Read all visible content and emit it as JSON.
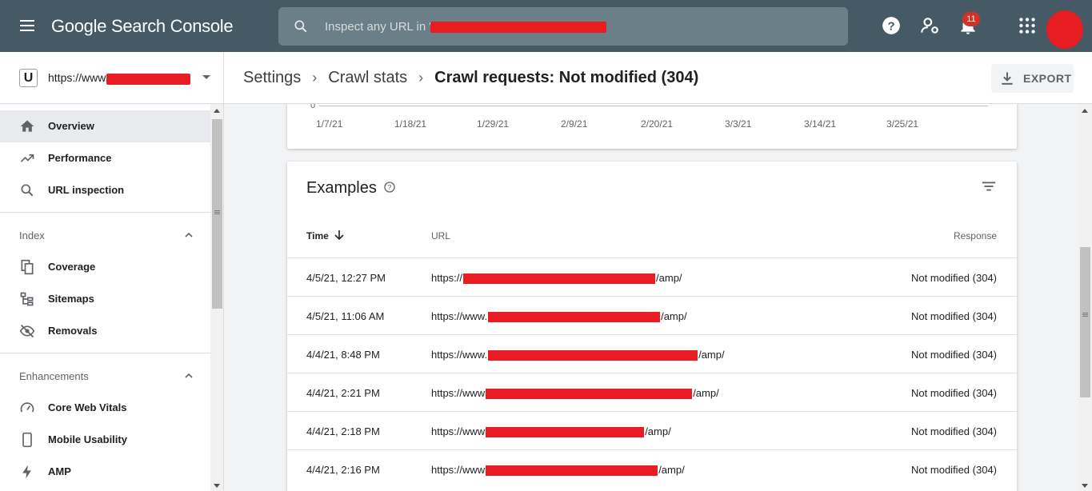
{
  "app": {
    "title": "Google Search Console",
    "search_placeholder": "Inspect any URL in \"https://",
    "notification_count": "11"
  },
  "property": {
    "logo_letter": "U",
    "url": "https://www."
  },
  "breadcrumb": {
    "items": [
      "Settings",
      "Crawl stats"
    ],
    "current": "Crawl requests: Not modified (304)"
  },
  "export_label": "EXPORT",
  "sidebar": {
    "items": [
      {
        "label": "Overview",
        "icon": "home-icon"
      },
      {
        "label": "Performance",
        "icon": "trending-up-icon"
      },
      {
        "label": "URL inspection",
        "icon": "search-icon"
      }
    ],
    "index_section": "Index",
    "index_items": [
      {
        "label": "Coverage",
        "icon": "coverage-icon"
      },
      {
        "label": "Sitemaps",
        "icon": "sitemap-icon"
      },
      {
        "label": "Removals",
        "icon": "eye-off-icon"
      }
    ],
    "enhancements_section": "Enhancements",
    "enhancement_items": [
      {
        "label": "Core Web Vitals",
        "icon": "speed-icon"
      },
      {
        "label": "Mobile Usability",
        "icon": "phone-icon"
      },
      {
        "label": "AMP",
        "icon": "bolt-icon"
      }
    ]
  },
  "chart": {
    "y_zero": "0",
    "x_ticks": [
      "1/7/21",
      "1/18/21",
      "1/29/21",
      "2/9/21",
      "2/20/21",
      "3/3/21",
      "3/14/21",
      "3/25/21"
    ]
  },
  "examples": {
    "title": "Examples",
    "columns": {
      "time": "Time",
      "url": "URL",
      "response": "Response"
    },
    "rows": [
      {
        "time": "4/5/21, 12:27 PM",
        "url_prefix": "https://",
        "url_suffix": "/amp/",
        "response": "Not modified (304)"
      },
      {
        "time": "4/5/21, 11:06 AM",
        "url_prefix": "https://www.",
        "url_suffix": "/amp/",
        "response": "Not modified (304)"
      },
      {
        "time": "4/4/21, 8:48 PM",
        "url_prefix": "https://www.",
        "url_suffix": "/amp/",
        "response": "Not modified (304)"
      },
      {
        "time": "4/4/21, 2:21 PM",
        "url_prefix": "https://www",
        "url_suffix": "/amp/",
        "response": "Not modified (304)"
      },
      {
        "time": "4/4/21, 2:18 PM",
        "url_prefix": "https://www",
        "url_suffix": "/amp/",
        "response": "Not modified (304)"
      },
      {
        "time": "4/4/21, 2:16 PM",
        "url_prefix": "https://www",
        "url_suffix": "/amp/",
        "response": "Not modified (304)"
      }
    ]
  },
  "colors": {
    "topbar": "#455a64",
    "accent_red": "#e81c23",
    "active_nav": "#e8eaed"
  }
}
